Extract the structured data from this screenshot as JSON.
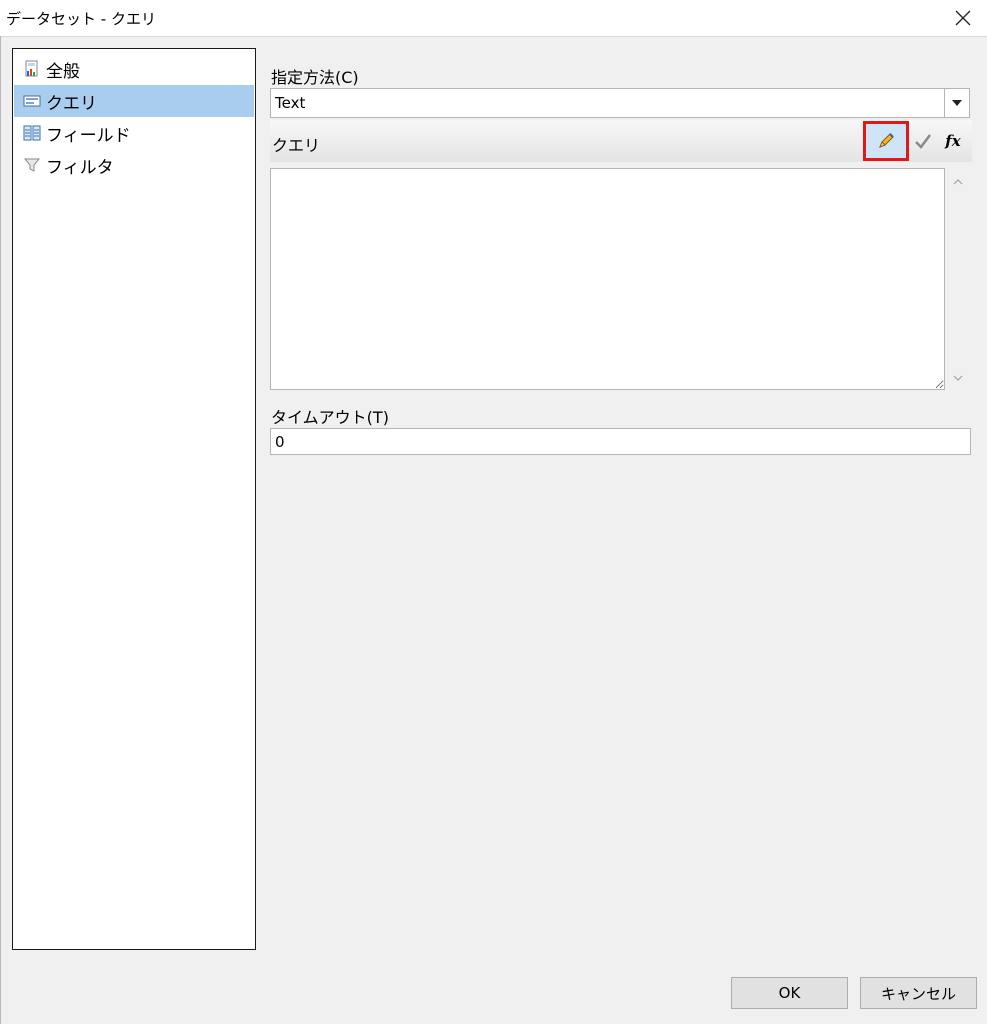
{
  "window": {
    "title": "データセット - クエリ"
  },
  "nav": {
    "items": [
      {
        "label": "全般",
        "icon": "general-report-icon"
      },
      {
        "label": "クエリ",
        "icon": "query-icon",
        "selected": true
      },
      {
        "label": "フィールド",
        "icon": "fields-icon"
      },
      {
        "label": "フィルタ",
        "icon": "filter-funnel-icon"
      }
    ]
  },
  "main": {
    "method_label": "指定方法(C)",
    "method_value": "Text",
    "query_label": "クエリ",
    "query_value": "",
    "toolbar": {
      "edit_icon": "pencil-icon",
      "validate_icon": "check-icon",
      "expression_label": "fx"
    },
    "timeout_label": "タイムアウト(T)",
    "timeout_value": "0"
  },
  "buttons": {
    "ok": "OK",
    "cancel": "キャンセル"
  },
  "colors": {
    "selected": "#a8cdee",
    "highlight": "#e01818"
  }
}
